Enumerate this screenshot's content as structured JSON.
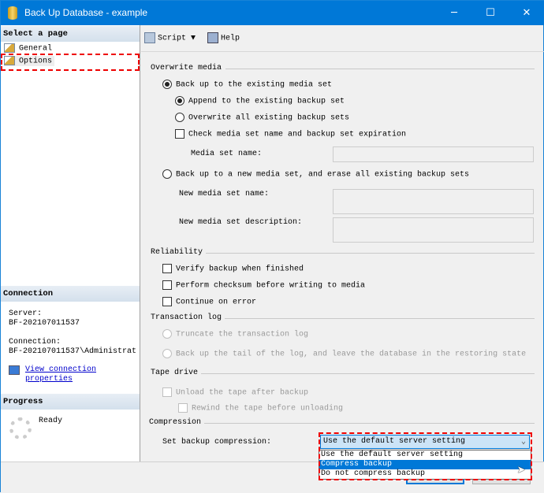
{
  "window": {
    "title": "Back Up Database - example",
    "minimize": "─",
    "maximize": "☐",
    "close": "✕"
  },
  "left": {
    "select_header": "Select a page",
    "pages": [
      {
        "label": "General"
      },
      {
        "label": "Options"
      }
    ],
    "connection_header": "Connection",
    "server_label": "Server:",
    "server_value": "BF-202107011537",
    "connection_label": "Connection:",
    "connection_value": "BF-202107011537\\Administrat",
    "view_link_1": "View connection",
    "view_link_2": "properties",
    "progress_header": "Progress",
    "progress_status": "Ready"
  },
  "toolbar": {
    "script": "Script",
    "help": "Help"
  },
  "overwrite": {
    "title": "Overwrite media",
    "existing": "Back up to the existing media set",
    "append": "Append to the existing backup set",
    "overwrite_all": "Overwrite all existing backup sets",
    "check": "Check media set name and backup set expiration",
    "media_name": "Media set name:",
    "new_set": "Back up to a new media set, and erase all existing backup sets",
    "new_name": "New media set name:",
    "new_desc": "New media set description:"
  },
  "reliability": {
    "title": "Reliability",
    "verify": "Verify backup when finished",
    "checksum": "Perform checksum before writing to media",
    "continue": "Continue on error"
  },
  "tlog": {
    "title": "Transaction log",
    "truncate": "Truncate the transaction log",
    "tail": "Back up the tail of the log, and leave the database in the restoring state"
  },
  "tape": {
    "title": "Tape drive",
    "unload": "Unload the tape after backup",
    "rewind": "Rewind the tape before unloading"
  },
  "compression": {
    "title": "Compression",
    "label": "Set backup compression:",
    "selected": "Use the default server setting",
    "options": [
      "Use the default server setting",
      "Compress backup",
      "Do not compress backup"
    ]
  }
}
